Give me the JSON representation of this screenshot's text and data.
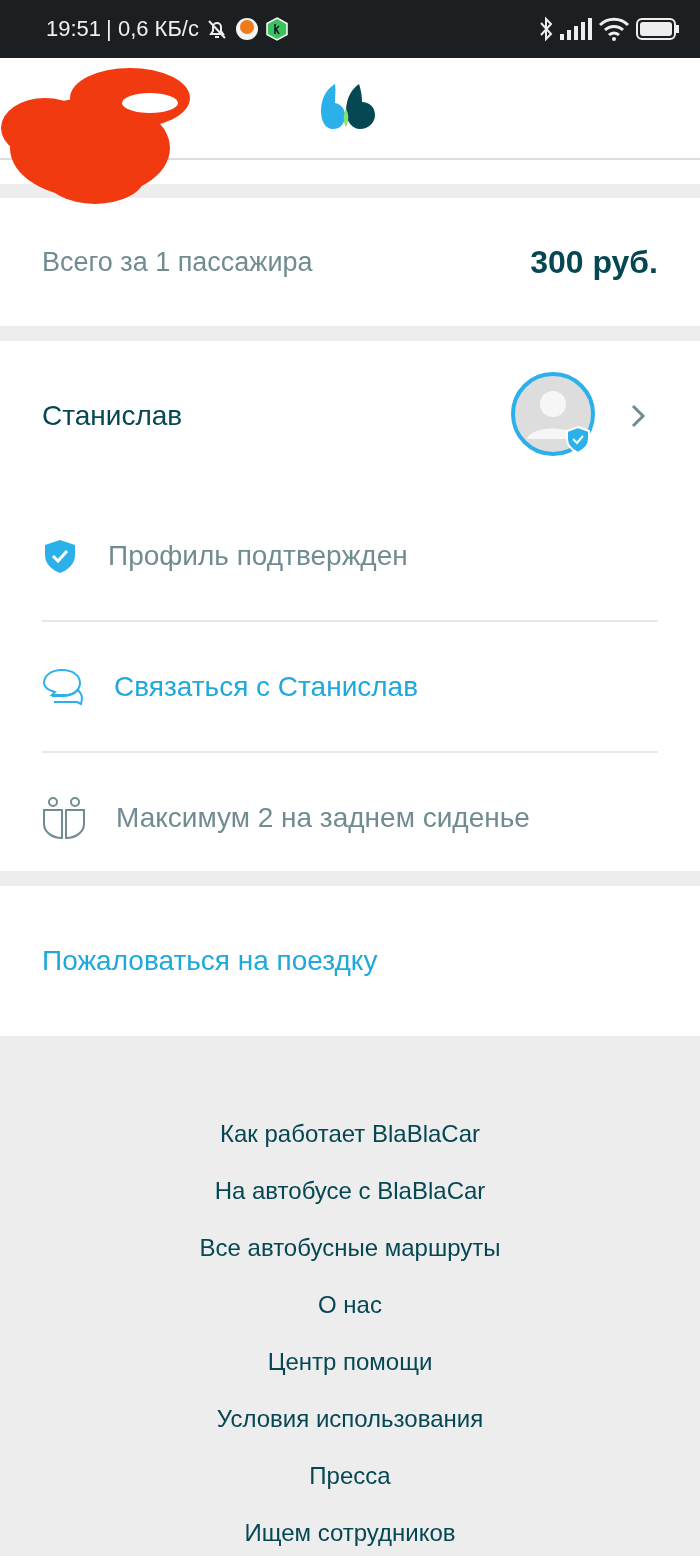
{
  "status_bar": {
    "time": "19:51",
    "speed": "| 0,6 КБ/с"
  },
  "price": {
    "label": "Всего за 1 пассажира",
    "amount": "300 руб."
  },
  "driver": {
    "name": "Станислав",
    "verified": true
  },
  "details": [
    {
      "kind": "verified",
      "text": "Профиль подтвержден"
    },
    {
      "kind": "contact",
      "text": "Связаться с Станислав"
    },
    {
      "kind": "seats",
      "text": "Максимум 2 на заднем сиденье"
    }
  ],
  "report_link": "Пожаловаться на поездку",
  "footer_links": [
    "Как работает BlaBlaCar",
    "На автобусе с BlaBlaCar",
    "Все автобусные маршруты",
    "О нас",
    "Центр помощи",
    "Условия использования",
    "Пресса",
    "Ищем сотрудников"
  ]
}
